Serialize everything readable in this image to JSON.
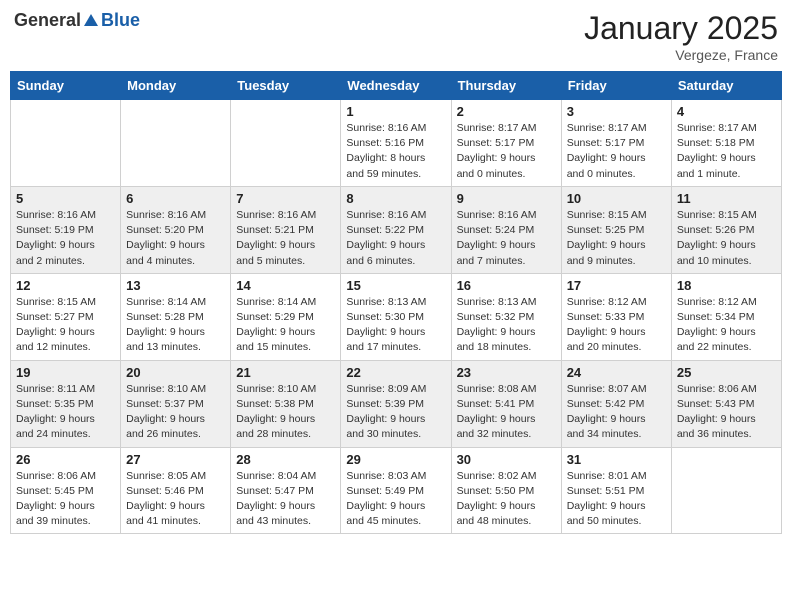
{
  "header": {
    "logo_general": "General",
    "logo_blue": "Blue",
    "month_year": "January 2025",
    "location": "Vergeze, France"
  },
  "weekdays": [
    "Sunday",
    "Monday",
    "Tuesday",
    "Wednesday",
    "Thursday",
    "Friday",
    "Saturday"
  ],
  "weeks": [
    [
      {
        "day": "",
        "sunrise": "",
        "sunset": "",
        "daylight": ""
      },
      {
        "day": "",
        "sunrise": "",
        "sunset": "",
        "daylight": ""
      },
      {
        "day": "",
        "sunrise": "",
        "sunset": "",
        "daylight": ""
      },
      {
        "day": "1",
        "sunrise": "Sunrise: 8:16 AM",
        "sunset": "Sunset: 5:16 PM",
        "daylight": "Daylight: 8 hours and 59 minutes."
      },
      {
        "day": "2",
        "sunrise": "Sunrise: 8:17 AM",
        "sunset": "Sunset: 5:17 PM",
        "daylight": "Daylight: 9 hours and 0 minutes."
      },
      {
        "day": "3",
        "sunrise": "Sunrise: 8:17 AM",
        "sunset": "Sunset: 5:17 PM",
        "daylight": "Daylight: 9 hours and 0 minutes."
      },
      {
        "day": "4",
        "sunrise": "Sunrise: 8:17 AM",
        "sunset": "Sunset: 5:18 PM",
        "daylight": "Daylight: 9 hours and 1 minute."
      }
    ],
    [
      {
        "day": "5",
        "sunrise": "Sunrise: 8:16 AM",
        "sunset": "Sunset: 5:19 PM",
        "daylight": "Daylight: 9 hours and 2 minutes."
      },
      {
        "day": "6",
        "sunrise": "Sunrise: 8:16 AM",
        "sunset": "Sunset: 5:20 PM",
        "daylight": "Daylight: 9 hours and 4 minutes."
      },
      {
        "day": "7",
        "sunrise": "Sunrise: 8:16 AM",
        "sunset": "Sunset: 5:21 PM",
        "daylight": "Daylight: 9 hours and 5 minutes."
      },
      {
        "day": "8",
        "sunrise": "Sunrise: 8:16 AM",
        "sunset": "Sunset: 5:22 PM",
        "daylight": "Daylight: 9 hours and 6 minutes."
      },
      {
        "day": "9",
        "sunrise": "Sunrise: 8:16 AM",
        "sunset": "Sunset: 5:24 PM",
        "daylight": "Daylight: 9 hours and 7 minutes."
      },
      {
        "day": "10",
        "sunrise": "Sunrise: 8:15 AM",
        "sunset": "Sunset: 5:25 PM",
        "daylight": "Daylight: 9 hours and 9 minutes."
      },
      {
        "day": "11",
        "sunrise": "Sunrise: 8:15 AM",
        "sunset": "Sunset: 5:26 PM",
        "daylight": "Daylight: 9 hours and 10 minutes."
      }
    ],
    [
      {
        "day": "12",
        "sunrise": "Sunrise: 8:15 AM",
        "sunset": "Sunset: 5:27 PM",
        "daylight": "Daylight: 9 hours and 12 minutes."
      },
      {
        "day": "13",
        "sunrise": "Sunrise: 8:14 AM",
        "sunset": "Sunset: 5:28 PM",
        "daylight": "Daylight: 9 hours and 13 minutes."
      },
      {
        "day": "14",
        "sunrise": "Sunrise: 8:14 AM",
        "sunset": "Sunset: 5:29 PM",
        "daylight": "Daylight: 9 hours and 15 minutes."
      },
      {
        "day": "15",
        "sunrise": "Sunrise: 8:13 AM",
        "sunset": "Sunset: 5:30 PM",
        "daylight": "Daylight: 9 hours and 17 minutes."
      },
      {
        "day": "16",
        "sunrise": "Sunrise: 8:13 AM",
        "sunset": "Sunset: 5:32 PM",
        "daylight": "Daylight: 9 hours and 18 minutes."
      },
      {
        "day": "17",
        "sunrise": "Sunrise: 8:12 AM",
        "sunset": "Sunset: 5:33 PM",
        "daylight": "Daylight: 9 hours and 20 minutes."
      },
      {
        "day": "18",
        "sunrise": "Sunrise: 8:12 AM",
        "sunset": "Sunset: 5:34 PM",
        "daylight": "Daylight: 9 hours and 22 minutes."
      }
    ],
    [
      {
        "day": "19",
        "sunrise": "Sunrise: 8:11 AM",
        "sunset": "Sunset: 5:35 PM",
        "daylight": "Daylight: 9 hours and 24 minutes."
      },
      {
        "day": "20",
        "sunrise": "Sunrise: 8:10 AM",
        "sunset": "Sunset: 5:37 PM",
        "daylight": "Daylight: 9 hours and 26 minutes."
      },
      {
        "day": "21",
        "sunrise": "Sunrise: 8:10 AM",
        "sunset": "Sunset: 5:38 PM",
        "daylight": "Daylight: 9 hours and 28 minutes."
      },
      {
        "day": "22",
        "sunrise": "Sunrise: 8:09 AM",
        "sunset": "Sunset: 5:39 PM",
        "daylight": "Daylight: 9 hours and 30 minutes."
      },
      {
        "day": "23",
        "sunrise": "Sunrise: 8:08 AM",
        "sunset": "Sunset: 5:41 PM",
        "daylight": "Daylight: 9 hours and 32 minutes."
      },
      {
        "day": "24",
        "sunrise": "Sunrise: 8:07 AM",
        "sunset": "Sunset: 5:42 PM",
        "daylight": "Daylight: 9 hours and 34 minutes."
      },
      {
        "day": "25",
        "sunrise": "Sunrise: 8:06 AM",
        "sunset": "Sunset: 5:43 PM",
        "daylight": "Daylight: 9 hours and 36 minutes."
      }
    ],
    [
      {
        "day": "26",
        "sunrise": "Sunrise: 8:06 AM",
        "sunset": "Sunset: 5:45 PM",
        "daylight": "Daylight: 9 hours and 39 minutes."
      },
      {
        "day": "27",
        "sunrise": "Sunrise: 8:05 AM",
        "sunset": "Sunset: 5:46 PM",
        "daylight": "Daylight: 9 hours and 41 minutes."
      },
      {
        "day": "28",
        "sunrise": "Sunrise: 8:04 AM",
        "sunset": "Sunset: 5:47 PM",
        "daylight": "Daylight: 9 hours and 43 minutes."
      },
      {
        "day": "29",
        "sunrise": "Sunrise: 8:03 AM",
        "sunset": "Sunset: 5:49 PM",
        "daylight": "Daylight: 9 hours and 45 minutes."
      },
      {
        "day": "30",
        "sunrise": "Sunrise: 8:02 AM",
        "sunset": "Sunset: 5:50 PM",
        "daylight": "Daylight: 9 hours and 48 minutes."
      },
      {
        "day": "31",
        "sunrise": "Sunrise: 8:01 AM",
        "sunset": "Sunset: 5:51 PM",
        "daylight": "Daylight: 9 hours and 50 minutes."
      },
      {
        "day": "",
        "sunrise": "",
        "sunset": "",
        "daylight": ""
      }
    ]
  ]
}
